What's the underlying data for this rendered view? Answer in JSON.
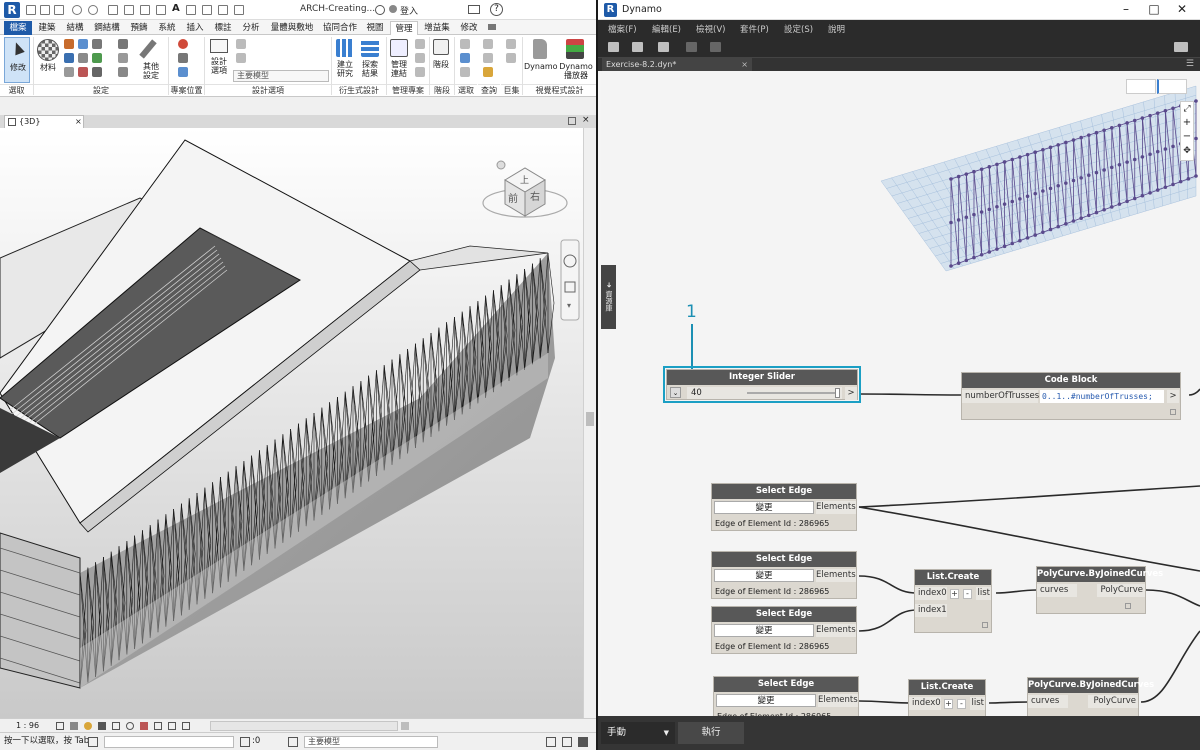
{
  "revit": {
    "doc_title": "ARCH-Creating...",
    "login": "登入",
    "help": "?",
    "tabs": [
      "檔案",
      "建築",
      "結構",
      "鋼結構",
      "預鑄",
      "系統",
      "插入",
      "標註",
      "分析",
      "量體與敷地",
      "協同合作",
      "視圖",
      "管理",
      "增益集",
      "修改"
    ],
    "active_tab": "管理",
    "ribbon": {
      "modify": "修改",
      "material": "材料",
      "other_settings_1": "其他",
      "other_settings_2": "設定",
      "design_options_1": "設計",
      "design_options_2": "選項",
      "main_model": "主要模型",
      "create_study_1": "建立",
      "create_study_2": "研究",
      "explore_results_1": "探索",
      "explore_results_2": "結果",
      "manage_links_1": "管理",
      "manage_links_2": "連結",
      "phase": "階段",
      "dynamo": "Dynamo",
      "dynamo_player_1": "Dynamo",
      "dynamo_player_2": "播放器",
      "panels": {
        "select": "選取",
        "settings": "設定",
        "project_location": "專案位置",
        "design_options": "設計選項",
        "generative_design": "衍生式設計",
        "manage_project": "管理專案",
        "phase": "階段",
        "selection": "選取",
        "inquiry": "查詢",
        "macros": "巨集",
        "visual_programming": "視覺程式設計"
      }
    },
    "view_tab": "{3D}",
    "viewcube": {
      "top": "上",
      "front": "前",
      "right": "右"
    },
    "scale": "1 : 96",
    "status_hint": "按一下以選取，按 Tab",
    "status_zero": ":0",
    "status_model": "主要模型"
  },
  "dynamo": {
    "app_name": "Dynamo",
    "menu": [
      "檔案(F)",
      "編輯(E)",
      "檢視(V)",
      "套件(P)",
      "設定(S)",
      "說明"
    ],
    "tab_name": "Exercise-8.2.dyn*",
    "librarian": "資源庫",
    "callout": "1",
    "run_mode": "手動",
    "run_label": "執行",
    "nodes": {
      "integer_slider": {
        "title": "Integer Slider",
        "value": "40",
        "out": ">"
      },
      "code_block": {
        "title": "Code Block",
        "input": "numberOfTrusses",
        "code": "0..1..#numberOfTrusses;",
        "out": ">"
      },
      "select_edge": {
        "title": "Select Edge",
        "button": "變更",
        "output": "Elements",
        "label": "Edge of Element Id : 286965"
      },
      "list_create": {
        "title": "List.Create",
        "in0": "index0",
        "in1": "index1",
        "plus": "+",
        "minus": "-",
        "out": "list"
      },
      "polycurve": {
        "title": "PolyCurve.ByJoinedCurves",
        "input": "curves",
        "output": "PolyCurve"
      }
    }
  },
  "colors": {
    "revit_blue": "#1e5aa8",
    "dynamo_dark": "#2b2b2b",
    "node_header": "#585858",
    "node_body": "#dcd8d0",
    "selection": "#1b9fc4",
    "truss": "#5a4a8c"
  }
}
